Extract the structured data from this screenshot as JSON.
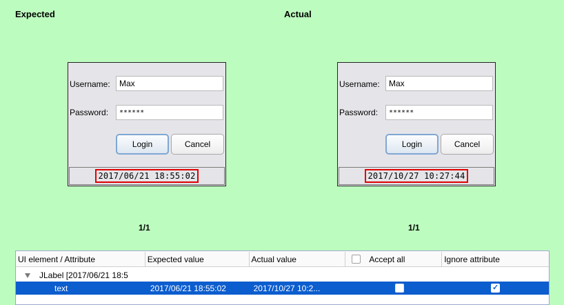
{
  "headings": {
    "expected": "Expected",
    "actual": "Actual"
  },
  "expected_window": {
    "username_label": "Username:",
    "username_value": "Max",
    "password_label": "Password:",
    "password_value": "******",
    "login_label": "Login",
    "cancel_label": "Cancel",
    "timestamp": "2017/06/21 18:55:02"
  },
  "actual_window": {
    "username_label": "Username:",
    "username_value": "Max",
    "password_label": "Password:",
    "password_value": "******",
    "login_label": "Login",
    "cancel_label": "Cancel",
    "timestamp": "2017/10/27 10:27:44"
  },
  "pager": {
    "expected": "1/1",
    "actual": "1/1"
  },
  "table": {
    "columns": [
      "UI element / Attribute",
      "Expected value",
      "Actual value",
      "Accept all",
      "Ignore attribute"
    ],
    "tree_row": "JLabel [2017/06/21 18:5",
    "selected_row": {
      "attribute": "text",
      "expected": "2017/06/21 18:55:02",
      "actual": "2017/10/27 10:2...",
      "accept": false,
      "ignore": true
    }
  },
  "colors": {
    "background": "#bdfcbf",
    "highlight_border": "#e00000",
    "selection": "#0c5dce"
  }
}
